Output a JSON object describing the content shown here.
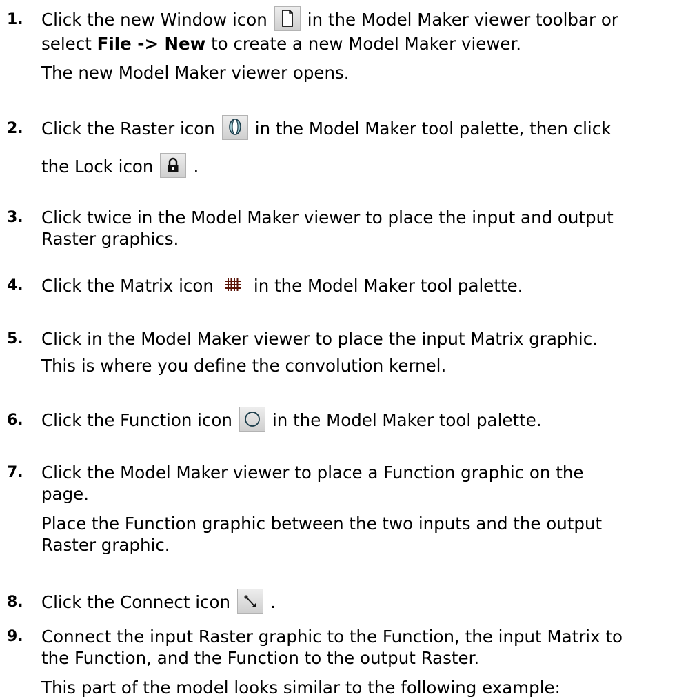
{
  "steps": [
    {
      "number": "1.",
      "line1_before": "Click the new Window icon",
      "icon": "new-window-icon",
      "line1_after": "in the Model Maker viewer toolbar or",
      "line2_before": "select",
      "line2_bold": "File -> New",
      "line2_after": "to create a new Model Maker viewer.",
      "note": "The new Model Maker viewer opens."
    },
    {
      "number": "2.",
      "line1_before": "Click the Raster icon",
      "icon": "raster-icon",
      "line1_after": "in the Model Maker tool palette, then click",
      "line2_before": "the Lock icon",
      "icon2": "lock-icon",
      "line2_after": "."
    },
    {
      "number": "3.",
      "line1": "Click twice in the Model Maker viewer to place the input and output",
      "line2": "Raster graphics."
    },
    {
      "number": "4.",
      "line1_before": "Click the Matrix icon",
      "icon": "matrix-icon",
      "line1_after": "in the Model Maker tool palette."
    },
    {
      "number": "5.",
      "line1": "Click in the Model Maker viewer to place the input Matrix graphic.",
      "note": "This is where you define the convolution kernel."
    },
    {
      "number": "6.",
      "line1_before": "Click the Function icon",
      "icon": "function-icon",
      "line1_after": "in the Model Maker tool palette."
    },
    {
      "number": "7.",
      "line1": "Click the Model Maker viewer to place a Function graphic on the",
      "line2": "page.",
      "note_line1": "Place the Function graphic between the two inputs and the output",
      "note_line2": "Raster graphic."
    },
    {
      "number": "8.",
      "line1_before": "Click the Connect icon",
      "icon": "connect-icon",
      "line1_after": "."
    },
    {
      "number": "9.",
      "line1": "Connect the input Raster graphic to the Function, the input Matrix to",
      "line2": "the Function, and the Function to the output Raster.",
      "note": "This part of the model looks similar to the following example:"
    }
  ]
}
